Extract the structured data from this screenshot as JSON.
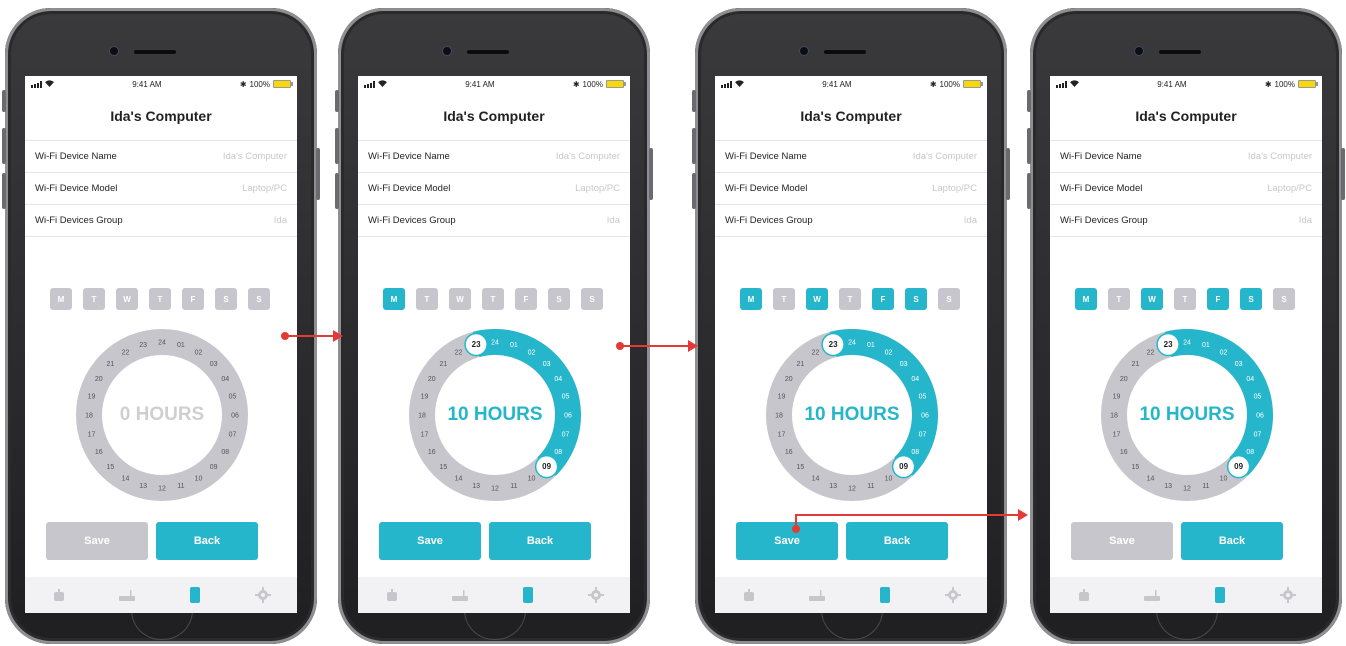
{
  "status": {
    "time": "9:41 AM",
    "battery": "100%",
    "bluetooth": "✱"
  },
  "header": {
    "title": "Ida's Computer"
  },
  "fields": [
    {
      "label": "Wi-Fi Device Name",
      "value": "Ida's Computer"
    },
    {
      "label": "Wi-Fi Device Model",
      "value": "Laptop/PC"
    },
    {
      "label": "Wi-Fi Devices Group",
      "value": "Ida"
    }
  ],
  "day_labels": [
    "M",
    "T",
    "W",
    "T",
    "F",
    "S",
    "S"
  ],
  "hour_labels": [
    "24",
    "01",
    "02",
    "03",
    "04",
    "05",
    "06",
    "07",
    "08",
    "09",
    "10",
    "11",
    "12",
    "13",
    "14",
    "15",
    "16",
    "17",
    "18",
    "19",
    "20",
    "21",
    "22",
    "23"
  ],
  "buttons": {
    "save": "Save",
    "back": "Back"
  },
  "tabs": [
    "robot-icon",
    "router-icon",
    "device-icon",
    "gear-icon"
  ],
  "colors": {
    "accent": "#25b6cc",
    "inactive": "#c6c6cc",
    "arrow": "#e53935"
  },
  "screens": [
    {
      "hours_label": "0 HOURS",
      "days_on": [],
      "start": null,
      "end": null,
      "save_enabled": false
    },
    {
      "hours_label": "10 HOURS",
      "days_on": [
        0
      ],
      "start": "23",
      "end": "09",
      "save_enabled": true
    },
    {
      "hours_label": "10 HOURS",
      "days_on": [
        0,
        2,
        4,
        5
      ],
      "start": "23",
      "end": "09",
      "save_enabled": true
    },
    {
      "hours_label": "10 HOURS",
      "days_on": [
        0,
        2,
        4,
        5
      ],
      "start": "23",
      "end": "09",
      "save_enabled": false
    }
  ]
}
